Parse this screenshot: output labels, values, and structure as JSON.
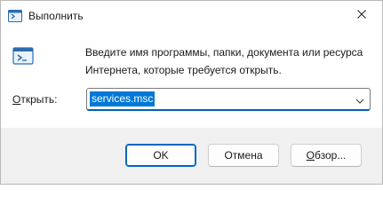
{
  "window": {
    "title": "Выполнить"
  },
  "description": {
    "line1": "Введите имя программы, папки, документа или ресурса",
    "line2": "Интернета, которые требуется открыть."
  },
  "open": {
    "label_underlined": "О",
    "label_rest": "ткрыть:",
    "value": "services.msc"
  },
  "buttons": {
    "ok": "OK",
    "cancel": "Отмена",
    "browse_underlined": "О",
    "browse_rest": "бзор..."
  },
  "colors": {
    "accent": "#0078d7",
    "footer_bg": "#f0f0f0"
  },
  "icons": {
    "title": "run-icon",
    "close": "close-icon",
    "dropdown": "chevron-down-icon"
  }
}
